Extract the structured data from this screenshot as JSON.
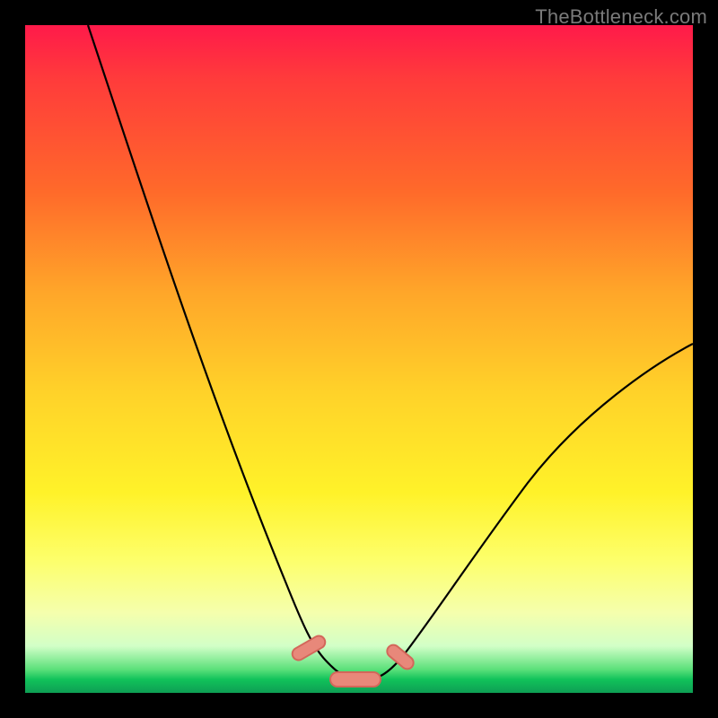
{
  "watermark": "TheBottleneck.com",
  "chart_data": {
    "type": "line",
    "title": "",
    "xlabel": "",
    "ylabel": "",
    "xlim": [
      0,
      100
    ],
    "ylim": [
      0,
      100
    ],
    "series": [
      {
        "name": "bottleneck-curve",
        "x": [
          10,
          15,
          20,
          25,
          30,
          35,
          40,
          45,
          48,
          50,
          52,
          55,
          60,
          65,
          70,
          75,
          80,
          85,
          90,
          95,
          100
        ],
        "y": [
          100,
          86,
          73,
          60,
          47,
          33,
          20,
          8,
          2,
          0,
          0,
          2,
          8,
          15,
          22,
          28,
          34,
          39,
          44,
          48,
          52
        ]
      }
    ],
    "annotations": [
      {
        "name": "optimal-bump-left",
        "x": 44,
        "y": 3
      },
      {
        "name": "optimal-bump-mid",
        "x": 50,
        "y": 0.5
      },
      {
        "name": "optimal-bump-right",
        "x": 56,
        "y": 3
      }
    ],
    "gradient_stops": [
      {
        "pos": 0,
        "color": "#ff1a4a"
      },
      {
        "pos": 25,
        "color": "#ff6a2a"
      },
      {
        "pos": 55,
        "color": "#ffd229"
      },
      {
        "pos": 80,
        "color": "#fdff6a"
      },
      {
        "pos": 97,
        "color": "#11c25a"
      },
      {
        "pos": 100,
        "color": "#0e9e54"
      }
    ]
  }
}
